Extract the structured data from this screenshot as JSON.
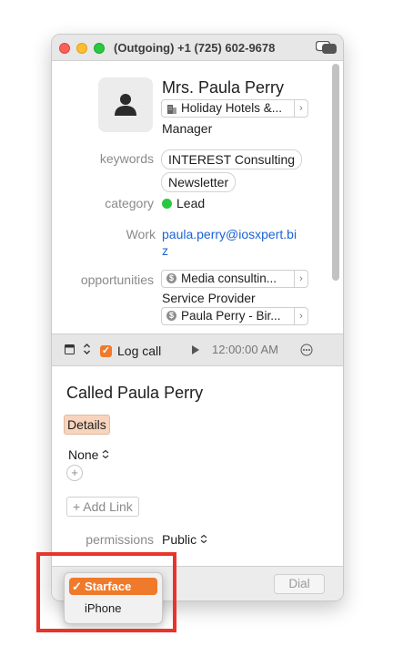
{
  "window": {
    "title": "(Outgoing) +1  (725) 602-9678"
  },
  "contact": {
    "name": "Mrs. Paula Perry",
    "company": "Holiday Hotels &...",
    "job_title": "Manager",
    "keywords_label": "keywords",
    "keywords": [
      "INTEREST Consulting",
      "Newsletter"
    ],
    "category_label": "category",
    "category_value": "Lead",
    "category_color": "#28c840",
    "email_label": "Work",
    "email_line1": "paula.perry@iosxpert.bi",
    "email_line2": "z",
    "opportunities_label": "opportunities",
    "opportunity1": "Media consultin...",
    "opportunity_role": "Service Provider",
    "opportunity2": "Paula Perry - Bir..."
  },
  "log_bar": {
    "log_call_label": "Log call",
    "log_call_checked": true,
    "time": "12:00:00 AM"
  },
  "activity": {
    "heading": "Called Paula Perry",
    "details_tab": "Details",
    "priority_value": "None",
    "add_link_label": "+ Add Link",
    "permissions_label": "permissions",
    "permissions_value": "Public"
  },
  "bottom": {
    "dial_label": "Dial"
  },
  "phone_menu": {
    "options": [
      {
        "label": "Starface",
        "selected": true
      },
      {
        "label": "iPhone",
        "selected": false
      }
    ]
  },
  "colors": {
    "accent": "#f07a2b",
    "link": "#1a63d6",
    "highlight_box": "#e8342a"
  },
  "icons": {
    "titlebar": "switch-toggle-icon",
    "company": "building-icon",
    "opportunity": "dollar-coin-icon",
    "calendar": "calendar-icon",
    "stepper": "chevron-updown-icon",
    "play": "play-icon",
    "more": "ellipsis-circle-icon",
    "add": "plus-circle-icon"
  }
}
